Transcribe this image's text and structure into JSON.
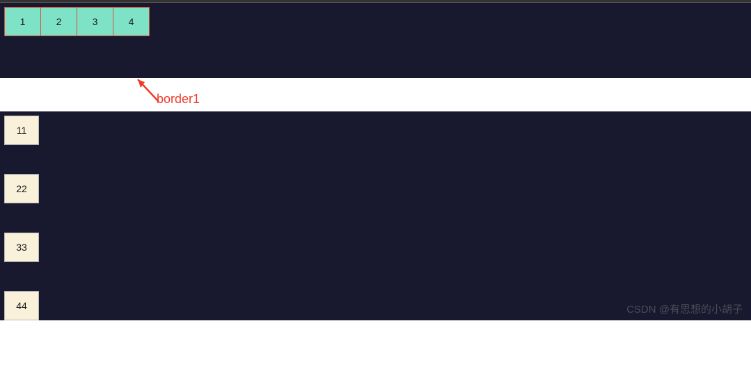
{
  "topRow": {
    "cells": [
      "1",
      "2",
      "3",
      "4"
    ]
  },
  "annotation": {
    "label": "border1"
  },
  "bottomRows": {
    "items": [
      "11",
      "22",
      "33",
      "44"
    ]
  },
  "watermark": "CSDN @有思想的小胡子",
  "colors": {
    "darkBg": "#18182f",
    "greenCell": "#7ee2c6",
    "redBorder": "#d84c3a",
    "beigeCell": "#faf1da",
    "annotation": "#ee3b2a"
  }
}
